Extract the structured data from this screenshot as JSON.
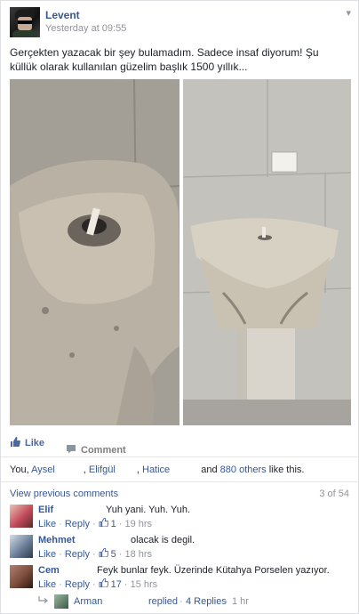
{
  "post": {
    "author": "Levent",
    "timestamp": "Yesterday at 09:55",
    "text": "Gerçekten yazacak bir şey bulamadım. Sadece insaf diyorum! Şu küllük olarak kullanılan güzelim başlık 1500 yıllık..."
  },
  "actions": {
    "like": "Like",
    "comment": "Comment"
  },
  "likes": {
    "prefix": "You,",
    "names": [
      "Aysel",
      "Elifgül",
      "Hatice"
    ],
    "and": "and",
    "others": "880 others",
    "suffix": "like this."
  },
  "comments_header": {
    "view_previous": "View previous comments",
    "count": "3 of 54"
  },
  "comments": [
    {
      "name": "Elif",
      "text": "Yuh yani. Yuh. Yuh.",
      "like": "Like",
      "reply": "Reply",
      "likes": "1",
      "time": "19 hrs",
      "avatar_color": "#c24a5a"
    },
    {
      "name": "Mehmet",
      "text": "olacak is degil.",
      "like": "Like",
      "reply": "Reply",
      "likes": "5",
      "time": "18 hrs",
      "avatar_color": "#6b7f9a"
    },
    {
      "name": "Cem",
      "text": "Feyk bunlar feyk. Üzerinde Kütahya Porselen yazıyor.",
      "like": "Like",
      "reply": "Reply",
      "likes": "17",
      "time": "15 hrs",
      "avatar_color": "#7a4a3a"
    }
  ],
  "reply_summary": {
    "name": "Arman",
    "replied": "replied",
    "replies": "4 Replies",
    "time": "1 hr"
  },
  "colors": {
    "link": "#365899",
    "meta": "#90949c",
    "accent": "#4b67a1"
  }
}
